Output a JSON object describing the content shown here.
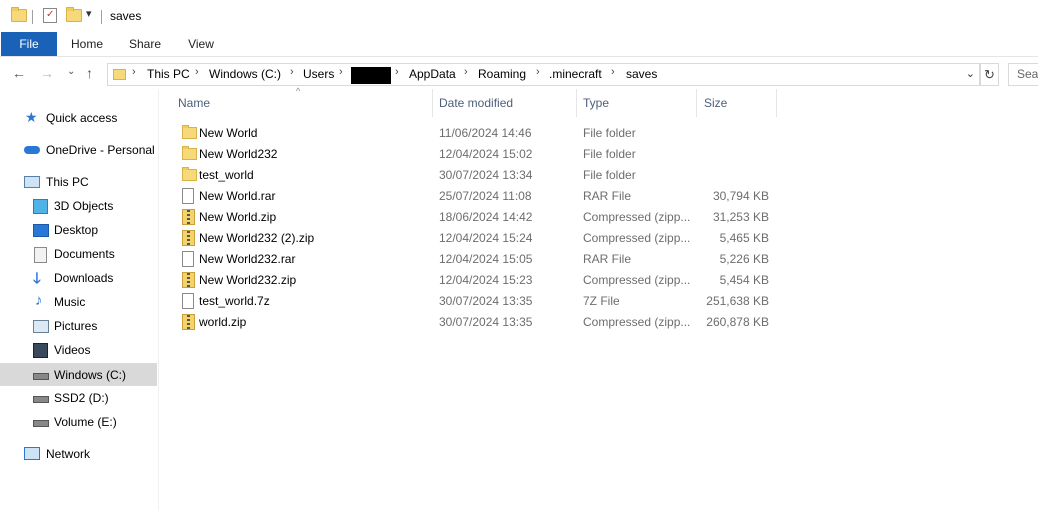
{
  "window": {
    "title": "saves"
  },
  "ribbon": {
    "tabs": [
      "File",
      "Home",
      "Share",
      "View"
    ]
  },
  "address": {
    "crumbs": [
      "This PC",
      "Windows (C:)",
      "Users",
      "AppData",
      "Roaming",
      ".minecraft",
      "saves"
    ],
    "search_placeholder": "Sear"
  },
  "nav": {
    "items": [
      {
        "label": "Quick access",
        "icon": "star-icon"
      },
      {
        "label": "OneDrive - Personal",
        "icon": "cloud-icon"
      },
      {
        "label": "This PC",
        "icon": "computer-icon"
      },
      {
        "label": "3D Objects",
        "icon": "cube-icon"
      },
      {
        "label": "Desktop",
        "icon": "desktop-icon"
      },
      {
        "label": "Documents",
        "icon": "documents-icon"
      },
      {
        "label": "Downloads",
        "icon": "download-arrow-icon"
      },
      {
        "label": "Music",
        "icon": "music-note-icon"
      },
      {
        "label": "Pictures",
        "icon": "pictures-icon"
      },
      {
        "label": "Videos",
        "icon": "film-icon"
      },
      {
        "label": "Windows (C:)",
        "icon": "drive-icon"
      },
      {
        "label": "SSD2 (D:)",
        "icon": "drive-icon"
      },
      {
        "label": "Volume (E:)",
        "icon": "drive-icon"
      },
      {
        "label": "Network",
        "icon": "network-icon"
      }
    ],
    "selected": "Windows (C:)"
  },
  "columns": [
    "Name",
    "Date modified",
    "Type",
    "Size"
  ],
  "files": [
    {
      "name": "New World",
      "date": "11/06/2024 14:46",
      "type": "File folder",
      "size": "",
      "kind": "folder"
    },
    {
      "name": "New World232",
      "date": "12/04/2024 15:02",
      "type": "File folder",
      "size": "",
      "kind": "folder"
    },
    {
      "name": "test_world",
      "date": "30/07/2024 13:34",
      "type": "File folder",
      "size": "",
      "kind": "folder"
    },
    {
      "name": "New World.rar",
      "date": "25/07/2024 11:08",
      "type": "RAR File",
      "size": "30,794 KB",
      "kind": "doc"
    },
    {
      "name": "New World.zip",
      "date": "18/06/2024 14:42",
      "type": "Compressed (zipp...",
      "size": "31,253 KB",
      "kind": "zip"
    },
    {
      "name": "New World232 (2).zip",
      "date": "12/04/2024 15:24",
      "type": "Compressed (zipp...",
      "size": "5,465 KB",
      "kind": "zip"
    },
    {
      "name": "New World232.rar",
      "date": "12/04/2024 15:05",
      "type": "RAR File",
      "size": "5,226 KB",
      "kind": "doc"
    },
    {
      "name": "New World232.zip",
      "date": "12/04/2024 15:23",
      "type": "Compressed (zipp...",
      "size": "5,454 KB",
      "kind": "zip"
    },
    {
      "name": "test_world.7z",
      "date": "30/07/2024 13:35",
      "type": "7Z File",
      "size": "251,638 KB",
      "kind": "doc"
    },
    {
      "name": "world.zip",
      "date": "30/07/2024 13:35",
      "type": "Compressed (zipp...",
      "size": "260,878 KB",
      "kind": "zip"
    }
  ],
  "colors": {
    "accent": "#1a62b8",
    "selected_bg": "#d9d9d9",
    "header_text": "#4c607a"
  }
}
